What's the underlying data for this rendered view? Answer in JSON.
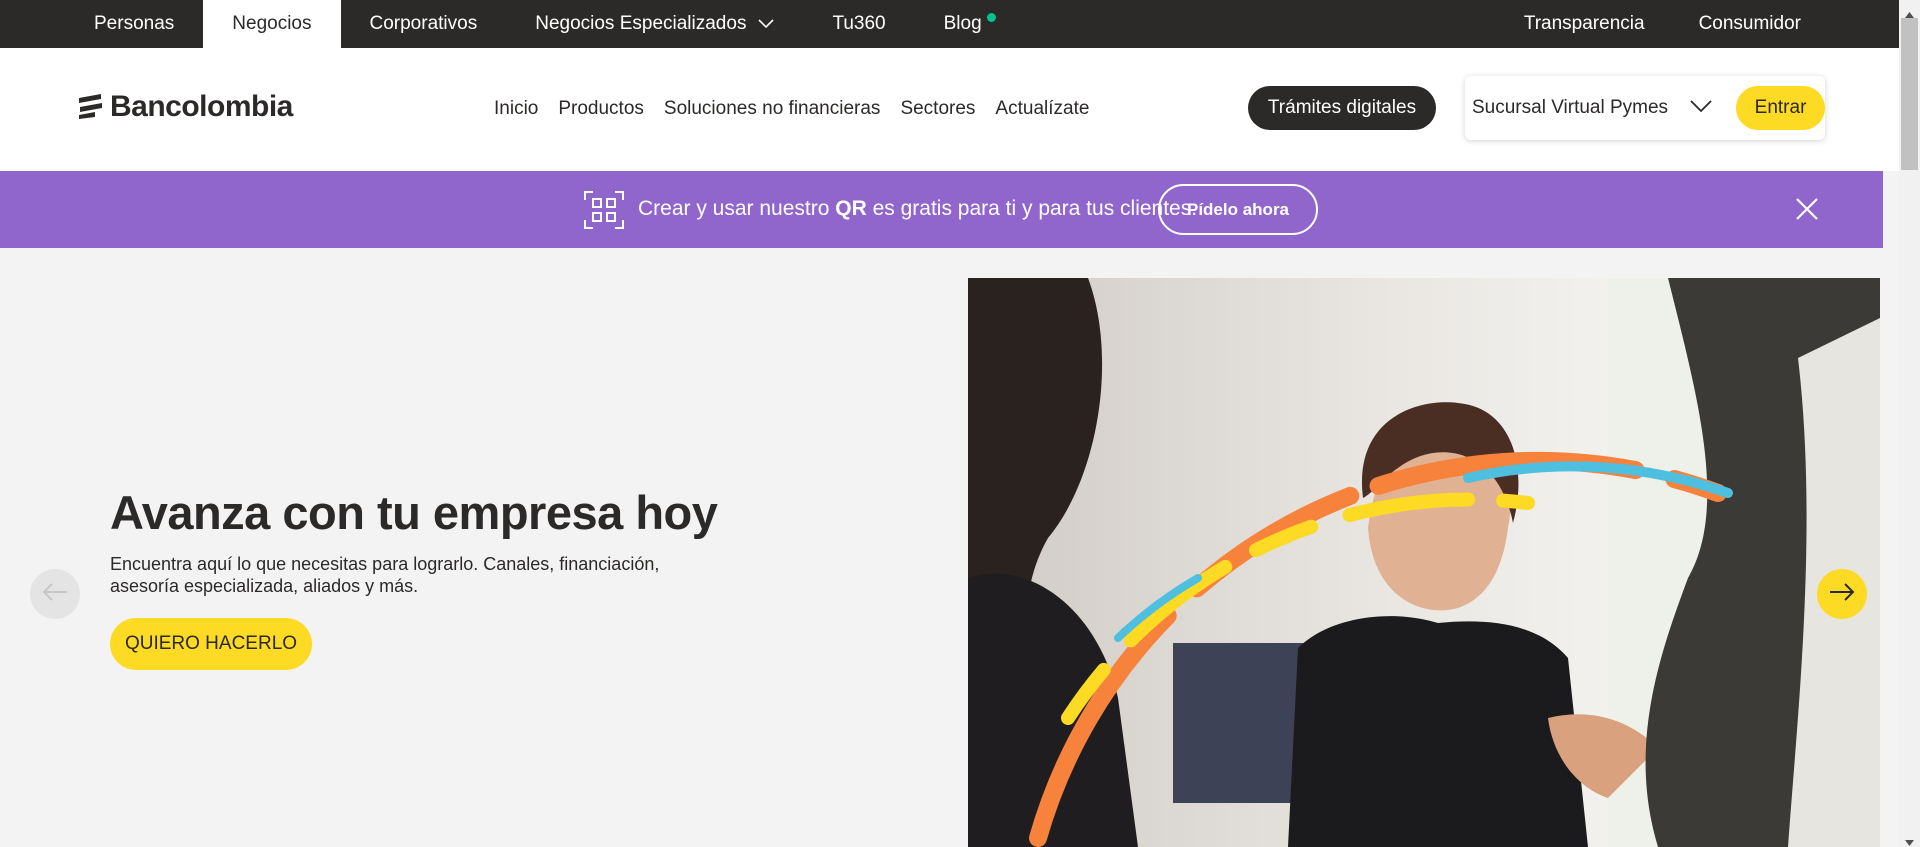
{
  "topbar": {
    "tabs": [
      {
        "label": "Personas"
      },
      {
        "label": "Negocios"
      },
      {
        "label": "Corporativos"
      },
      {
        "label": "Negocios Especializados"
      },
      {
        "label": "Tu360"
      },
      {
        "label": "Blog"
      }
    ],
    "right": [
      {
        "label": "Transparencia"
      },
      {
        "label": "Consumidor"
      }
    ],
    "active_tab": "Negocios"
  },
  "header": {
    "logo_text": "Bancolombia",
    "nav": [
      {
        "label": "Inicio"
      },
      {
        "label": "Productos"
      },
      {
        "label": "Soluciones no financieras"
      },
      {
        "label": "Sectores"
      },
      {
        "label": "Actualízate"
      }
    ],
    "tramites_label": "Trámites digitales",
    "sucursal_label": "Sucursal Virtual Pymes",
    "entrar_label": "Entrar"
  },
  "promo": {
    "text_before": "Crear y usar nuestro ",
    "text_bold": "QR",
    "text_after": " es gratis para ti y para tus clientes.",
    "button_label": "Pídelo ahora"
  },
  "hero": {
    "title": "Avanza con tu empresa hoy",
    "subtitle": "Encuentra aquí lo que necesitas para lograrlo. Canales, financiación, asesoría especializada, aliados y más.",
    "cta_label": "QUIERO HACERLO"
  },
  "colors": {
    "dark": "#2c2a29",
    "yellow": "#fdda24",
    "purple": "#9166cc",
    "blog_dot": "#00c389",
    "hero_bg": "#f3f3f3"
  },
  "icons": [
    "qr-code-icon",
    "close-icon",
    "chevron-down-icon",
    "arrow-left-icon",
    "arrow-right-icon",
    "bancolombia-logo-icon"
  ]
}
